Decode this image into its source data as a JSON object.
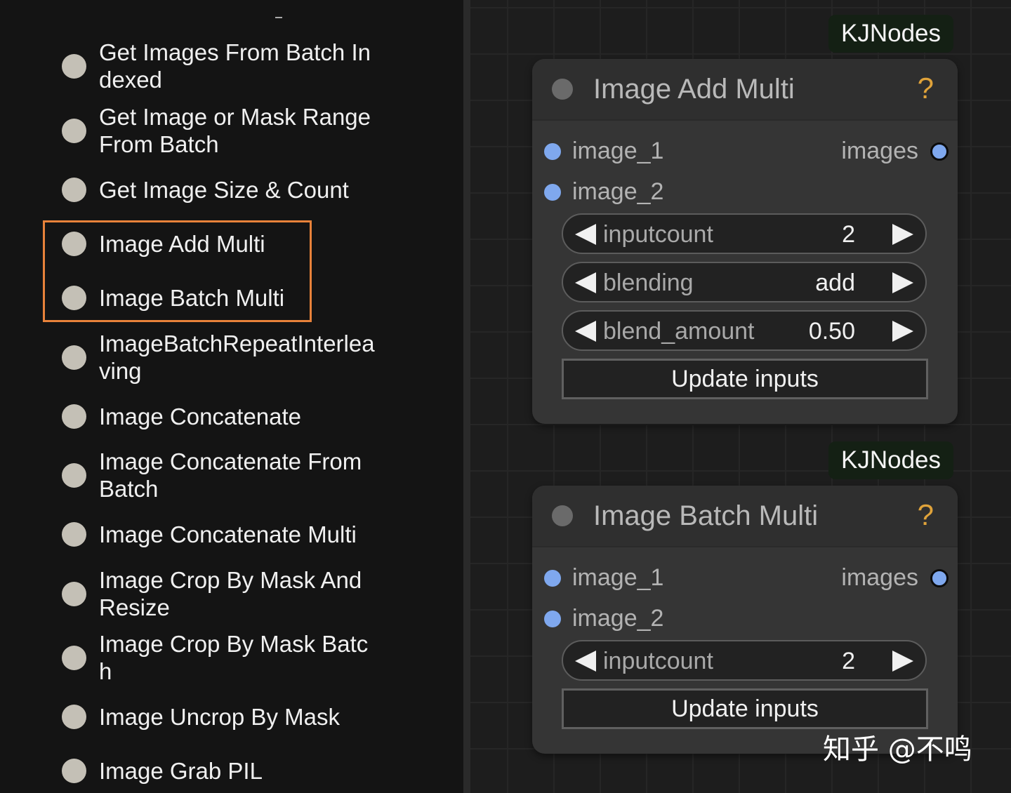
{
  "menu": {
    "items": [
      {
        "label": "Get Images From Batch Indexed"
      },
      {
        "label": "Get Image or Mask Range From Batch"
      },
      {
        "label": "Get Image Size & Count"
      },
      {
        "label": "Image Add Multi"
      },
      {
        "label": "Image Batch Multi"
      },
      {
        "label": "ImageBatchRepeatInterleaving"
      },
      {
        "label": "Image Concatenate"
      },
      {
        "label": "Image Concatenate From Batch"
      },
      {
        "label": "Image Concatenate Multi"
      },
      {
        "label": "Image Crop By Mask And Resize"
      },
      {
        "label": "Image Crop By Mask Batch"
      },
      {
        "label": "Image Uncrop By Mask"
      },
      {
        "label": "Image Grab PIL"
      }
    ]
  },
  "nodes": [
    {
      "badge": "KJNodes",
      "title": "Image Add Multi",
      "help": "?",
      "inputs": [
        "image_1",
        "image_2"
      ],
      "output": "images",
      "widgets": [
        {
          "name": "inputcount",
          "value": "2"
        },
        {
          "name": "blending",
          "value": "add"
        },
        {
          "name": "blend_amount",
          "value": "0.50"
        }
      ],
      "button": "Update inputs"
    },
    {
      "badge": "KJNodes",
      "title": "Image Batch Multi",
      "help": "?",
      "inputs": [
        "image_1",
        "image_2"
      ],
      "output": "images",
      "widgets": [
        {
          "name": "inputcount",
          "value": "2"
        }
      ],
      "button": "Update inputs"
    }
  ],
  "watermark": "知乎 @不鸣",
  "colors": {
    "highlight": "#e8823a",
    "slot": "#7fa8ee",
    "help": "#e0a33a",
    "badge_bg": "#142014"
  }
}
